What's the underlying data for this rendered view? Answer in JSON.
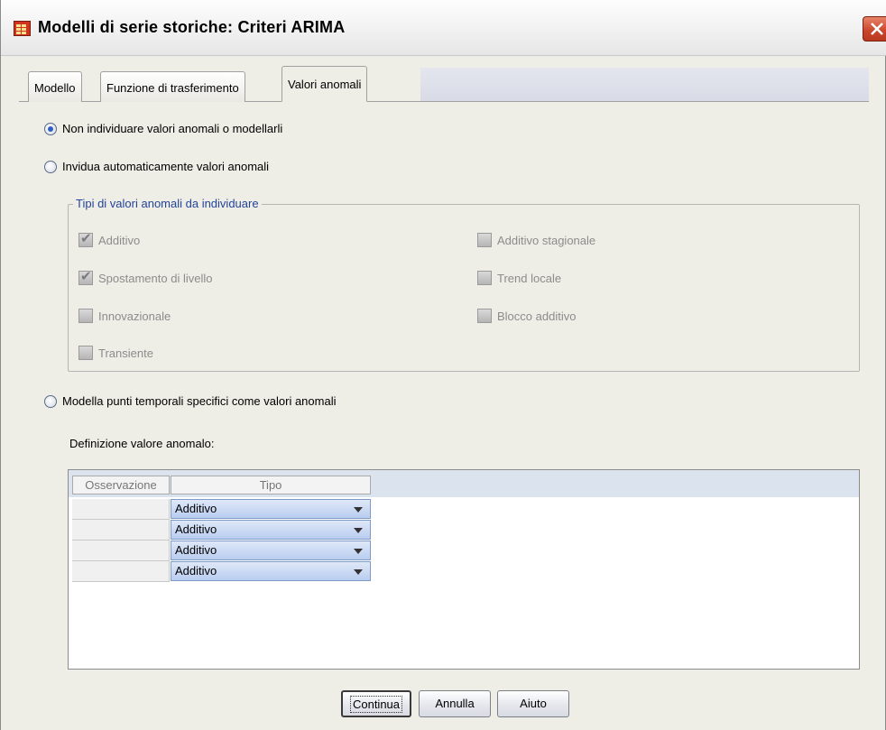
{
  "window": {
    "title": "Modelli di serie storiche: Criteri ARIMA"
  },
  "tabs": [
    {
      "label": "Modello"
    },
    {
      "label": "Funzione di trasferimento"
    },
    {
      "label": "Valori anomali"
    }
  ],
  "options": {
    "no_detect": "Non individuare valori anomali o modellarli",
    "auto_detect": "Invidua automaticamente valori anomali",
    "specific": "Modella punti temporali specifici come valori anomali",
    "selected": "no_detect"
  },
  "outlier_types": {
    "title": "Tipi di valori anomali da individuare",
    "left": [
      {
        "label": "Additivo",
        "checked": true
      },
      {
        "label": "Spostamento di livello",
        "checked": true
      },
      {
        "label": "Innovazionale",
        "checked": false
      },
      {
        "label": "Transiente",
        "checked": false
      }
    ],
    "right": [
      {
        "label": "Additivo stagionale",
        "checked": false
      },
      {
        "label": "Trend locale",
        "checked": false
      },
      {
        "label": "Blocco additivo",
        "checked": false
      }
    ]
  },
  "definition": {
    "label": "Definizione valore anomalo:",
    "columns": [
      "Osservazione",
      "Tipo"
    ],
    "rows": [
      {
        "observation": "",
        "type": "Additivo"
      },
      {
        "observation": "",
        "type": "Additivo"
      },
      {
        "observation": "",
        "type": "Additivo"
      },
      {
        "observation": "",
        "type": "Additivo"
      }
    ]
  },
  "buttons": {
    "continue": "Continua",
    "cancel": "Annulla",
    "help": "Aiuto"
  }
}
